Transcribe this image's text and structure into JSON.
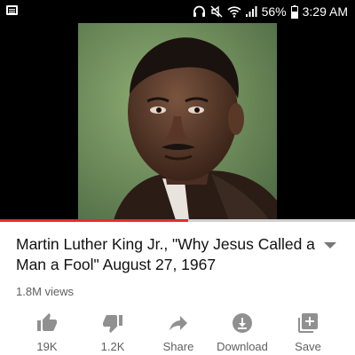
{
  "status_bar": {
    "battery": "56%",
    "time": "3:29 AM"
  },
  "video": {
    "progress_fraction": 0.53
  },
  "title": "Martin Luther King Jr., \"Why Jesus Called a Man a Fool\" August 27, 1967",
  "views": "1.8M views",
  "actions": [
    {
      "label": "19K",
      "icon": "thumbs-up-icon"
    },
    {
      "label": "1.2K",
      "icon": "thumbs-down-icon"
    },
    {
      "label": "Share",
      "icon": "share-icon"
    },
    {
      "label": "Download",
      "icon": "download-icon"
    },
    {
      "label": "Save",
      "icon": "save-to-playlist-icon"
    }
  ],
  "colors": {
    "progress": "#e52d27",
    "icon": "#909090",
    "text": "#111111",
    "secondary_text": "#606060"
  }
}
